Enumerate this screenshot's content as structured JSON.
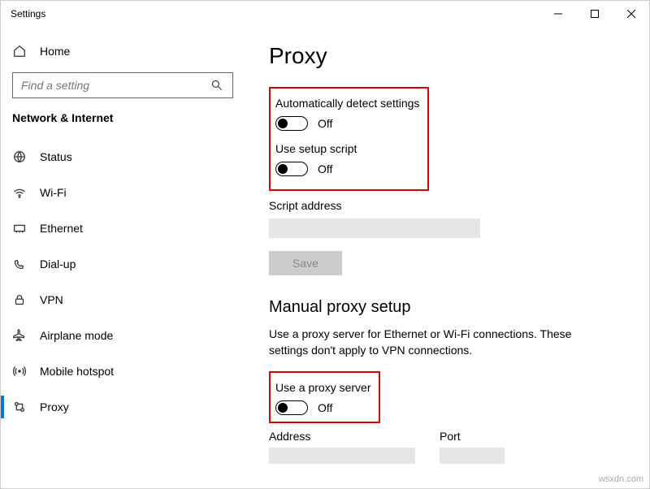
{
  "window": {
    "title": "Settings"
  },
  "sidebar": {
    "home": "Home",
    "search_placeholder": "Find a setting",
    "category": "Network & Internet",
    "items": [
      {
        "label": "Status"
      },
      {
        "label": "Wi-Fi"
      },
      {
        "label": "Ethernet"
      },
      {
        "label": "Dial-up"
      },
      {
        "label": "VPN"
      },
      {
        "label": "Airplane mode"
      },
      {
        "label": "Mobile hotspot"
      },
      {
        "label": "Proxy"
      }
    ]
  },
  "page": {
    "title": "Proxy",
    "auto_detect_label": "Automatically detect settings",
    "auto_detect_state": "Off",
    "use_script_label": "Use setup script",
    "use_script_state": "Off",
    "script_address_label": "Script address",
    "script_address_value": "",
    "save_label": "Save",
    "manual_heading": "Manual proxy setup",
    "manual_desc": "Use a proxy server for Ethernet or Wi-Fi connections. These settings don't apply to VPN connections.",
    "use_proxy_label": "Use a proxy server",
    "use_proxy_state": "Off",
    "address_label": "Address",
    "address_value": "",
    "port_label": "Port",
    "port_value": ""
  },
  "watermark": "wsxdn.com"
}
